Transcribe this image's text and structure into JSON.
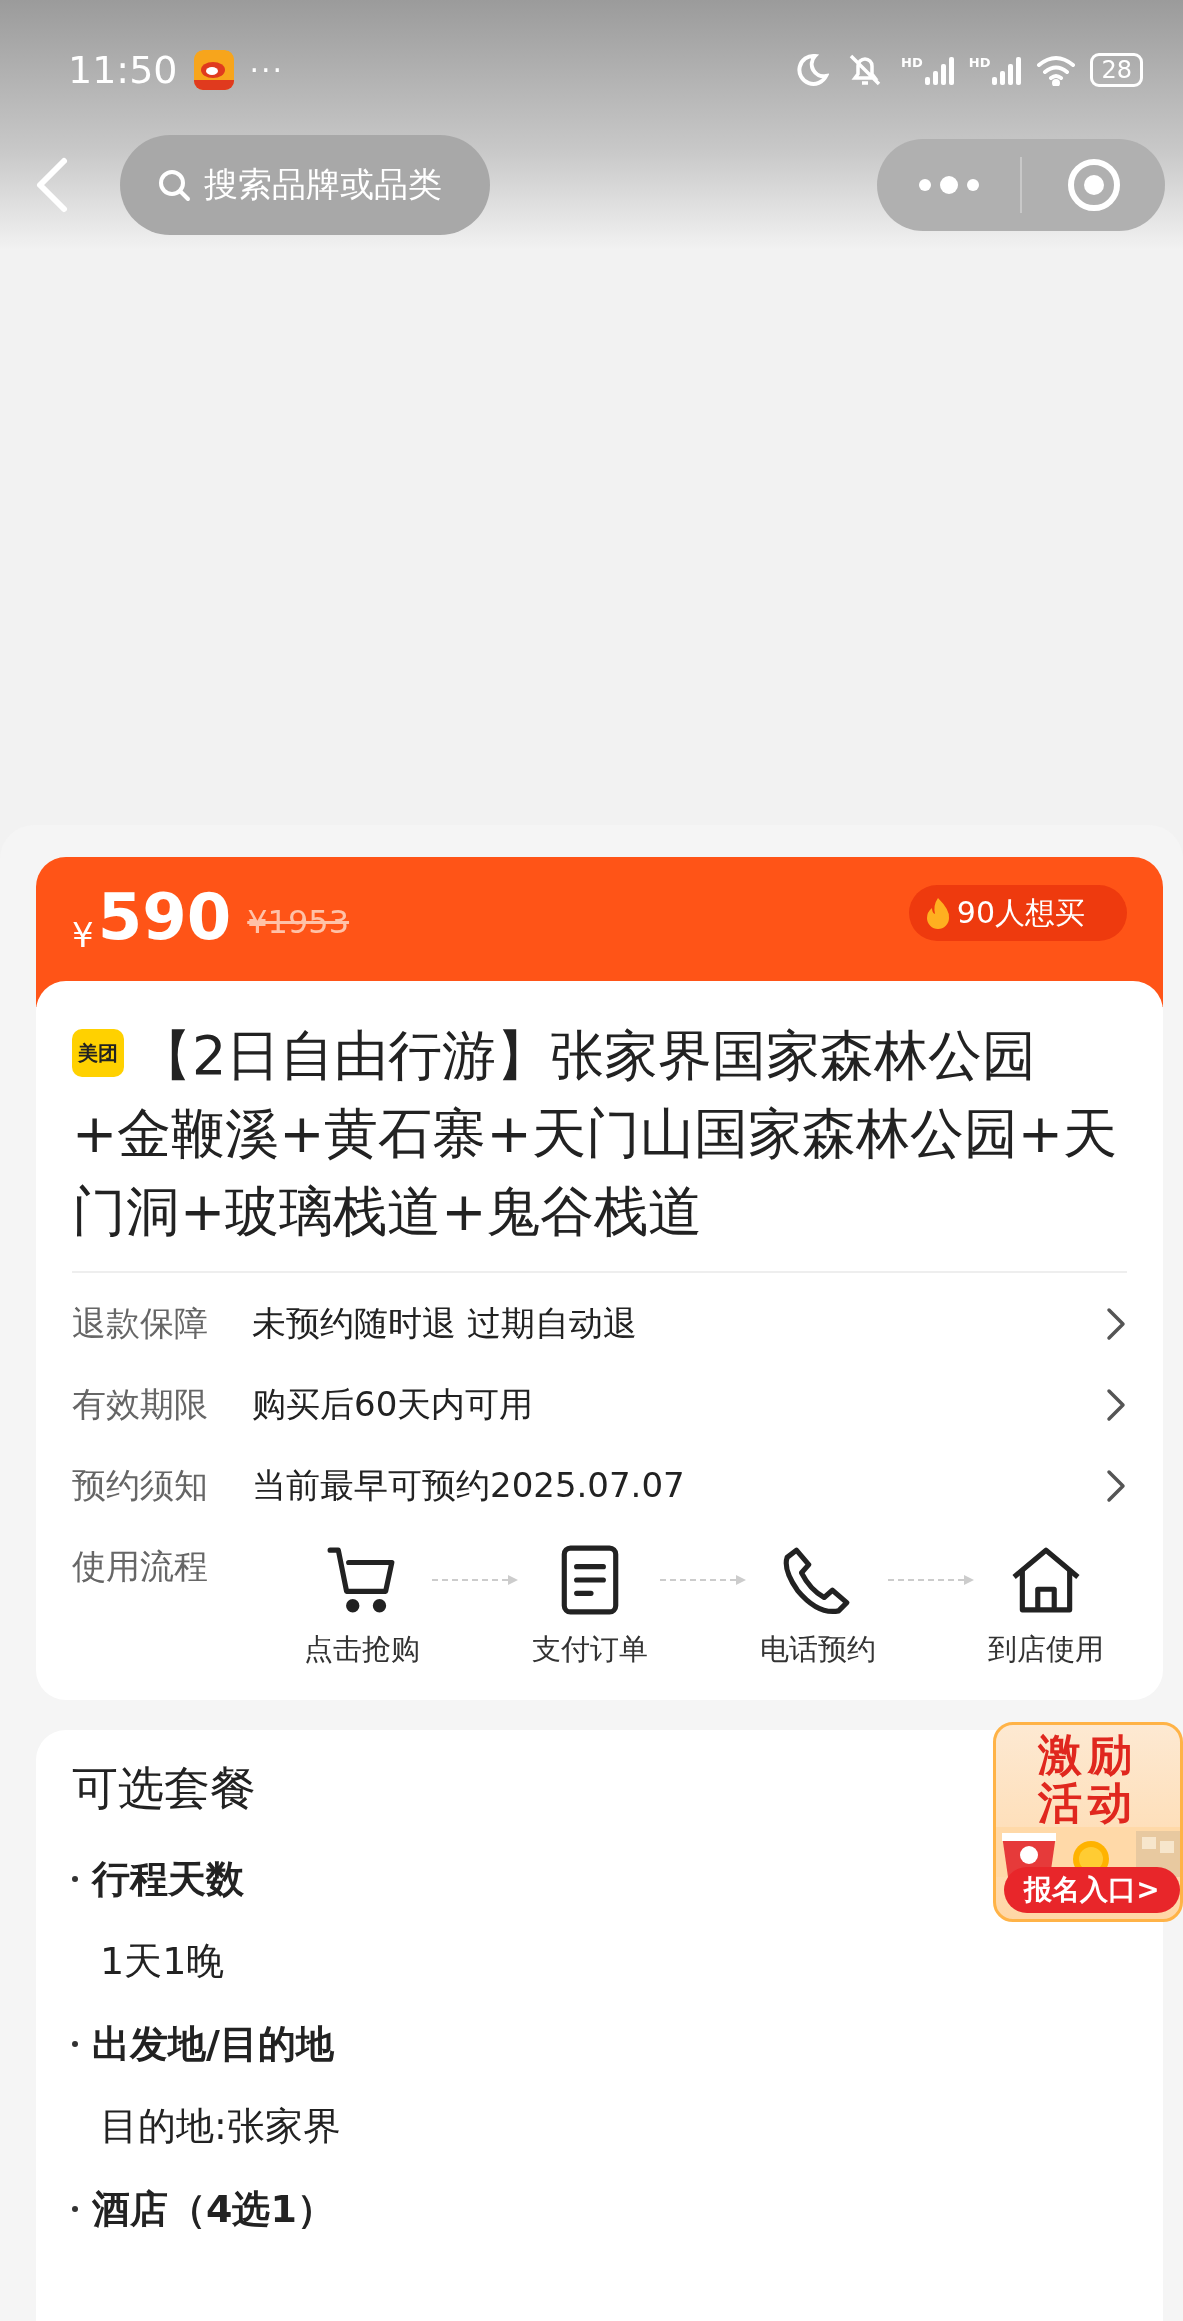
{
  "status_bar": {
    "time": "11:50",
    "more": "···",
    "signals": [
      {
        "label": "HD"
      },
      {
        "label": "HD"
      }
    ],
    "battery": "28"
  },
  "nav": {
    "search_placeholder": "搜索品牌或品类"
  },
  "price": {
    "currency": "¥",
    "current": "590",
    "original": "¥1953",
    "popularity": "90人想买"
  },
  "product": {
    "brand": "美团",
    "title": "【2日自由行游】张家界国家森林公园+金鞭溪+黄石寨+天门山国家森林公园+天门洞+玻璃栈道+鬼谷栈道"
  },
  "info_rows": [
    {
      "label": "退款保障",
      "value": "未预约随时退 过期自动退"
    },
    {
      "label": "有效期限",
      "value": "购买后60天内可用"
    },
    {
      "label": "预约须知",
      "value": "当前最早可预约2025.07.07"
    }
  ],
  "process": {
    "label": "使用流程",
    "steps": [
      {
        "kind": "cart",
        "label": "点击抢购"
      },
      {
        "kind": "document",
        "label": "支付订单"
      },
      {
        "kind": "phone",
        "label": "电话预约"
      },
      {
        "kind": "store",
        "label": "到店使用"
      }
    ]
  },
  "promo": {
    "title_lines": [
      "激励",
      "活动"
    ],
    "button": "报名入口>"
  },
  "packages": {
    "title": "可选套餐",
    "groups": [
      {
        "name": "行程天数",
        "value": "1天1晚"
      },
      {
        "name": "出发地/目的地",
        "value": "目的地:张家界"
      },
      {
        "name": "酒店（4选1）"
      }
    ]
  }
}
